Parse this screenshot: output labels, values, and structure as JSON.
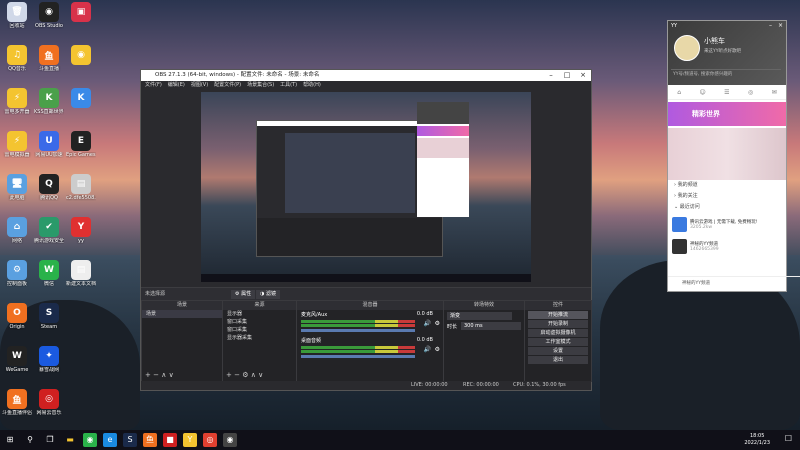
{
  "desktop": {
    "icons": [
      {
        "label": "回收站",
        "col": 0,
        "row": 0,
        "color": "#d0d8e8",
        "glyph": "🗑"
      },
      {
        "label": "OBS Studio",
        "col": 1,
        "row": 0,
        "color": "#222",
        "glyph": "◉"
      },
      {
        "label": "",
        "col": 2,
        "row": 0,
        "color": "#d8324a",
        "glyph": "▣"
      },
      {
        "label": "QQ音乐",
        "col": 0,
        "row": 1,
        "color": "#f4c430",
        "glyph": "♫"
      },
      {
        "label": "斗鱼直播",
        "col": 1,
        "row": 1,
        "color": "#f07020",
        "glyph": "鱼"
      },
      {
        "label": "",
        "col": 2,
        "row": 1,
        "color": "#f4c430",
        "glyph": "◉"
      },
      {
        "label": "雷电多开器",
        "col": 0,
        "row": 2,
        "color": "#f4c430",
        "glyph": "⚡"
      },
      {
        "label": "KSS直邮世界卡牌游戏",
        "col": 1,
        "row": 2,
        "color": "#4aa04a",
        "glyph": "K"
      },
      {
        "label": "",
        "col": 2,
        "row": 2,
        "color": "#3a8ae8",
        "glyph": "K"
      },
      {
        "label": "雷电模拟器",
        "col": 0,
        "row": 3,
        "color": "#f4c430",
        "glyph": "⚡"
      },
      {
        "label": "网易UU加速",
        "col": 1,
        "row": 3,
        "color": "#3a6ae8",
        "glyph": "U"
      },
      {
        "label": "Epic Games Launcher",
        "col": 2,
        "row": 3,
        "color": "#222",
        "glyph": "E"
      },
      {
        "label": "此电脑",
        "col": 0,
        "row": 4,
        "color": "#5aa0e0",
        "glyph": "🖥"
      },
      {
        "label": "腾讯QQ",
        "col": 1,
        "row": 4,
        "color": "#222",
        "glyph": "Q"
      },
      {
        "label": "c2.dfe5508...",
        "col": 2,
        "row": 4,
        "color": "#ccc",
        "glyph": "▤"
      },
      {
        "label": "网络",
        "col": 0,
        "row": 5,
        "color": "#5aa0e0",
        "glyph": "⌂"
      },
      {
        "label": "腾讯游戏安全服务",
        "col": 1,
        "row": 5,
        "color": "#2a9a6a",
        "glyph": "✔"
      },
      {
        "label": "yy",
        "col": 2,
        "row": 5,
        "color": "#e03030",
        "glyph": "Y"
      },
      {
        "label": "控制面板",
        "col": 0,
        "row": 6,
        "color": "#5aa0e0",
        "glyph": "⚙"
      },
      {
        "label": "微信",
        "col": 1,
        "row": 6,
        "color": "#2ab24a",
        "glyph": "W"
      },
      {
        "label": "新建文本文档",
        "col": 2,
        "row": 6,
        "color": "#eee",
        "glyph": "▤"
      },
      {
        "label": "Origin",
        "col": 0,
        "row": 7,
        "color": "#f07020",
        "glyph": "O"
      },
      {
        "label": "Steam",
        "col": 1,
        "row": 7,
        "color": "#1a2a4a",
        "glyph": "S"
      },
      {
        "label": "WeGame",
        "col": 0,
        "row": 8,
        "color": "#222",
        "glyph": "W"
      },
      {
        "label": "暴雪战网",
        "col": 1,
        "row": 8,
        "color": "#1a5ae0",
        "glyph": "✦"
      },
      {
        "label": "斗鱼直播伴侣",
        "col": 0,
        "row": 9,
        "color": "#f07020",
        "glyph": "鱼"
      },
      {
        "label": "网易云音乐",
        "col": 1,
        "row": 9,
        "color": "#d02020",
        "glyph": "◎"
      }
    ]
  },
  "obs": {
    "title": "OBS 27.1.3 (64-bit, windows) - 配置文件: 未命名 - 场景: 未命名",
    "menu": [
      "文件(F)",
      "编辑(E)",
      "视图(V)",
      "配置文件(P)",
      "场景集合(S)",
      "工具(T)",
      "帮助(H)"
    ],
    "scene_bar": {
      "label": "未选择源",
      "props": "属性",
      "filters": "滤镜"
    },
    "docks": {
      "scenes": {
        "title": "场景",
        "items": [
          "场景"
        ]
      },
      "sources": {
        "title": "来源",
        "items": [
          "显示器",
          "窗口采集",
          "窗口采集",
          "显示器采集"
        ]
      },
      "mixer": {
        "title": "混音器",
        "channels": [
          {
            "name": "麦克风/Aux",
            "db": "0.0 dB"
          },
          {
            "name": "桌面音频",
            "db": "0.0 dB"
          }
        ]
      },
      "transitions": {
        "title": "转场特效",
        "type": "渐变",
        "duration_label": "时长",
        "duration": "300 ms"
      },
      "controls": {
        "title": "控件",
        "buttons": [
          "开始推流",
          "开始录制",
          "启动虚拟摄像机",
          "工作室模式",
          "设置",
          "退出"
        ]
      }
    },
    "status": {
      "live": "LIVE: 00:00:00",
      "rec": "REC: 00:00:00",
      "cpu": "CPU: 0.1%, 30.00 fps"
    }
  },
  "yy": {
    "brand": "YY",
    "username": "小熊车",
    "status_text": "来这YY听点好歌吧",
    "search_placeholder": "YY号/频道号, 搜索你感兴趣的",
    "banner": "精彩世界",
    "menu": [
      "我的频道",
      "我的关注",
      "最近访问"
    ],
    "recent": [
      {
        "title": "腾讯云游戏 | 无需下载, 免费畅玩!",
        "meta": "3205.2kw"
      },
      {
        "title": "神秘的YY频道",
        "meta": "1462665399"
      }
    ],
    "footer": "神秘的YY频道"
  },
  "taskbar": {
    "time": "18:05",
    "date": "2022/1/23"
  }
}
